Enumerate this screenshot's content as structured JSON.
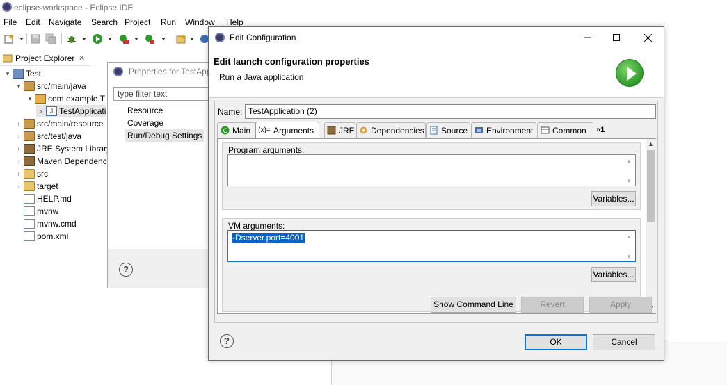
{
  "window": {
    "title": "eclipse-workspace - Eclipse IDE",
    "menu": [
      "File",
      "Edit",
      "Navigate",
      "Search",
      "Project",
      "Run",
      "Window",
      "Help"
    ]
  },
  "explorer": {
    "tab_label": "Project Explorer",
    "tree": [
      {
        "label": "Test",
        "icon": "project-icon"
      },
      {
        "label": "src/main/java",
        "icon": "source-folder-icon"
      },
      {
        "label": "com.example.T",
        "icon": "package-icon"
      },
      {
        "label": "TestApplicati",
        "icon": "java-file-icon"
      },
      {
        "label": "src/main/resource",
        "icon": "source-folder-icon"
      },
      {
        "label": "src/test/java",
        "icon": "source-folder-icon"
      },
      {
        "label": "JRE System Library",
        "icon": "library-icon"
      },
      {
        "label": "Maven Dependenc",
        "icon": "library-icon"
      },
      {
        "label": "src",
        "icon": "folder-icon"
      },
      {
        "label": "target",
        "icon": "folder-icon"
      },
      {
        "label": "HELP.md",
        "icon": "file-icon"
      },
      {
        "label": "mvnw",
        "icon": "file-icon"
      },
      {
        "label": "mvnw.cmd",
        "icon": "file-icon"
      },
      {
        "label": "pom.xml",
        "icon": "file-icon"
      }
    ]
  },
  "properties": {
    "title": "Properties for TestApp",
    "filter_placeholder": "type filter text",
    "items": [
      "Resource",
      "Coverage",
      "Run/Debug Settings"
    ]
  },
  "dialog": {
    "title": "Edit Configuration",
    "header_title": "Edit launch configuration properties",
    "header_subtitle": "Run a Java application",
    "name_label": "Name:",
    "name_value": "TestApplication (2)",
    "tabs": [
      "Main",
      "Arguments",
      "JRE",
      "Dependencies",
      "Source",
      "Environment",
      "Common",
      "»1"
    ],
    "active_tab": "Arguments",
    "program_args_label": "Program arguments:",
    "program_args_value": "",
    "vm_args_label": "VM arguments:",
    "vm_args_value": "-Dserver.port=4001",
    "variables_label": "Variables...",
    "show_command_line": "Show Command Line",
    "revert": "Revert",
    "apply": "Apply",
    "ok": "OK",
    "cancel": "Cancel"
  },
  "colors": {
    "selection": "#0a64c8",
    "focus_border": "#1a6fc9",
    "run_badge": "#2e9a2a"
  }
}
